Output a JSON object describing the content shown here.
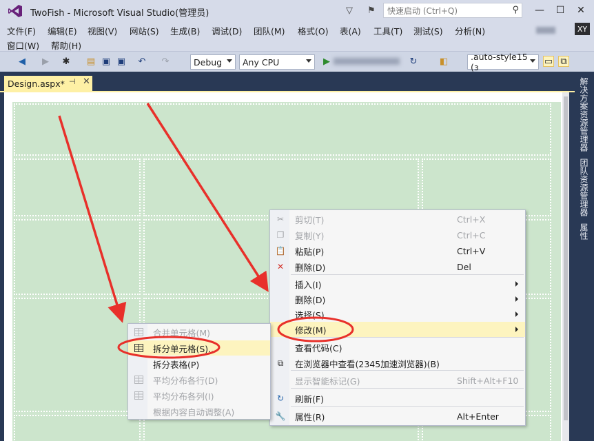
{
  "window": {
    "title": "TwoFish - Microsoft Visual Studio(管理员)",
    "quick_launch_placeholder": "快速启动 (Ctrl+Q)",
    "user_initials": "XY"
  },
  "menubar": {
    "row1": [
      "文件(F)",
      "编辑(E)",
      "视图(V)",
      "网站(S)",
      "生成(B)",
      "调试(D)",
      "团队(M)",
      "格式(O)",
      "表(A)",
      "工具(T)",
      "测试(S)",
      "分析(N)"
    ],
    "row2": [
      "窗口(W)",
      "帮助(H)"
    ]
  },
  "toolbar": {
    "config": "Debug",
    "platform": "Any CPU",
    "style_selector": ".auto-style15 (ɜ"
  },
  "document_tab": {
    "name": "Design.aspx*",
    "pin_glyph": "⊣",
    "close_glyph": "✕"
  },
  "side_panels": [
    "解决方案资源管理器",
    "团队资源管理器",
    "属性"
  ],
  "context_menu": [
    {
      "label": "剪切(T)",
      "shortcut": "Ctrl+X",
      "disabled": true,
      "icon": "scissors-icon",
      "glyph": "✂"
    },
    {
      "label": "复制(Y)",
      "shortcut": "Ctrl+C",
      "disabled": true,
      "icon": "copy-icon",
      "glyph": "❐"
    },
    {
      "label": "粘贴(P)",
      "shortcut": "Ctrl+V",
      "disabled": false,
      "icon": "paste-icon",
      "glyph": "📋"
    },
    {
      "label": "删除(D)",
      "shortcut": "Del",
      "disabled": false,
      "icon": "delete-icon",
      "glyph": "✕"
    },
    {
      "label": "插入(I)",
      "shortcut": "",
      "disabled": false,
      "submenu": true
    },
    {
      "label": "删除(D)",
      "shortcut": "",
      "disabled": false,
      "submenu": true
    },
    {
      "label": "选择(S)",
      "shortcut": "",
      "disabled": false,
      "submenu": true
    },
    {
      "label": "修改(M)",
      "shortcut": "",
      "disabled": false,
      "submenu": true,
      "highlighted": true
    },
    {
      "label": "查看代码(C)",
      "shortcut": "",
      "disabled": false
    },
    {
      "label": "在浏览器中查看(2345加速浏览器)(B)",
      "shortcut": "",
      "disabled": false,
      "icon": "browser-icon",
      "glyph": "⧉"
    },
    {
      "label": "显示智能标记(G)",
      "shortcut": "Shift+Alt+F10",
      "disabled": true
    },
    {
      "label": "刷新(F)",
      "shortcut": "",
      "disabled": false,
      "icon": "refresh-icon",
      "glyph": "↻"
    },
    {
      "label": "属性(R)",
      "shortcut": "Alt+Enter",
      "disabled": false,
      "icon": "wrench-icon",
      "glyph": "🔧"
    }
  ],
  "submenu": [
    {
      "label": "合并单元格(M)",
      "disabled": true,
      "icon": "merge-cells-icon"
    },
    {
      "label": "拆分单元格(S)...",
      "disabled": false,
      "highlighted": true,
      "icon": "table-grid-icon"
    },
    {
      "label": "拆分表格(P)",
      "disabled": false
    },
    {
      "label": "平均分布各行(D)",
      "disabled": true,
      "icon": "distribute-rows-icon"
    },
    {
      "label": "平均分布各列(I)",
      "disabled": true,
      "icon": "distribute-cols-icon"
    },
    {
      "label": "根据内容自动调整(A)",
      "disabled": true
    }
  ],
  "colors": {
    "annotation_red": "#e8302a",
    "menu_highlight": "#fdf4bf",
    "tab_active": "#fef0a5",
    "canvas_green": "#cce5cc"
  }
}
